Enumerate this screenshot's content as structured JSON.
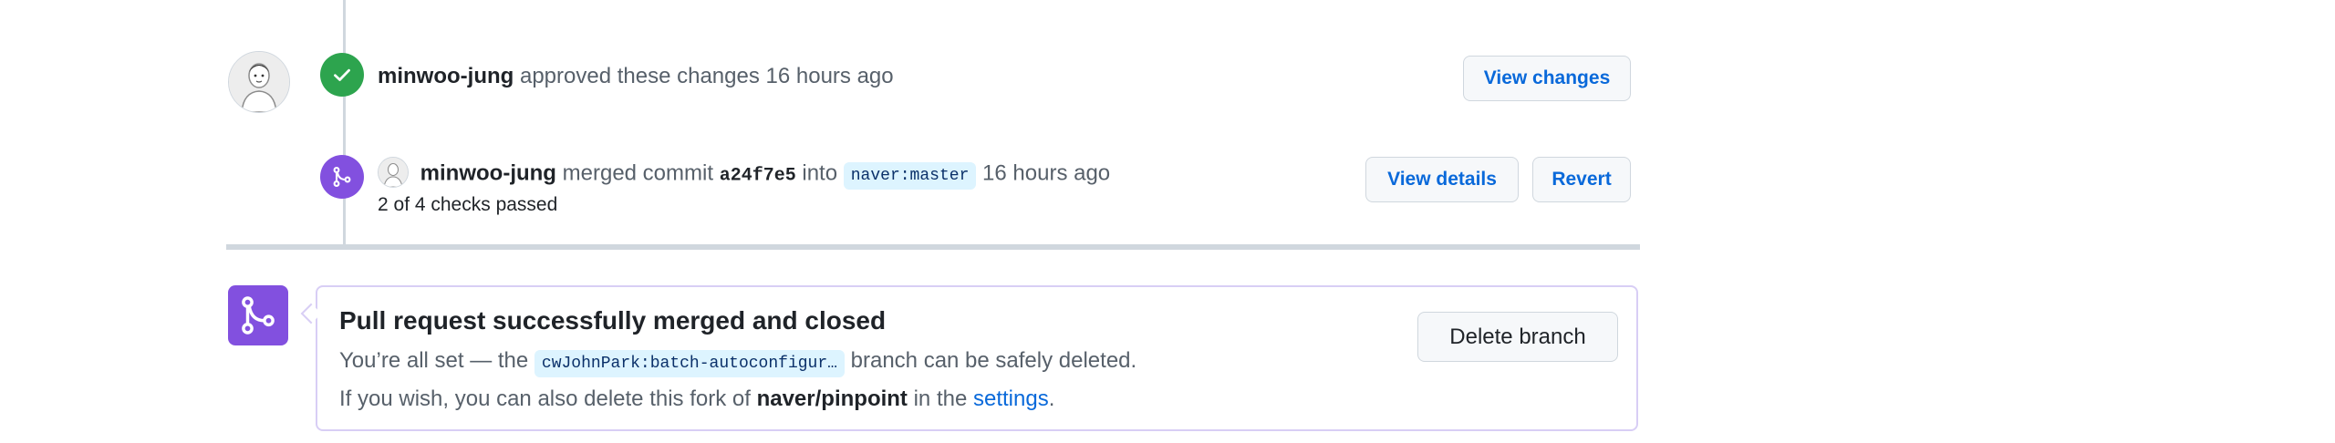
{
  "review_event": {
    "user": "minwoo-jung",
    "action": "approved these changes",
    "time": "16 hours ago",
    "view_changes_label": "View changes"
  },
  "merge_event": {
    "user": "minwoo-jung",
    "action_1": "merged commit",
    "commit_sha": "a24f7e5",
    "action_2": "into",
    "target_branch": "naver:master",
    "time": "16 hours ago",
    "checks_status": "2 of 4 checks passed",
    "view_details_label": "View details",
    "revert_label": "Revert"
  },
  "merged_box": {
    "title": "Pull request successfully merged and closed",
    "line1_prefix": "You’re all set — the",
    "branch_name": "cwJohnPark:batch-autoconfigur…",
    "line1_suffix": "branch can be safely deleted.",
    "line2_prefix": "If you wish, you can also delete this fork of",
    "repo_name": "naver/pinpoint",
    "line2_middle": "in the",
    "settings_link": "settings",
    "line2_end": ".",
    "delete_branch_label": "Delete branch"
  },
  "colors": {
    "approved": "#2da44e",
    "merged": "#8250df",
    "link": "#0969da"
  },
  "icons": {
    "approved": "check-icon",
    "merged": "git-merge-icon"
  }
}
